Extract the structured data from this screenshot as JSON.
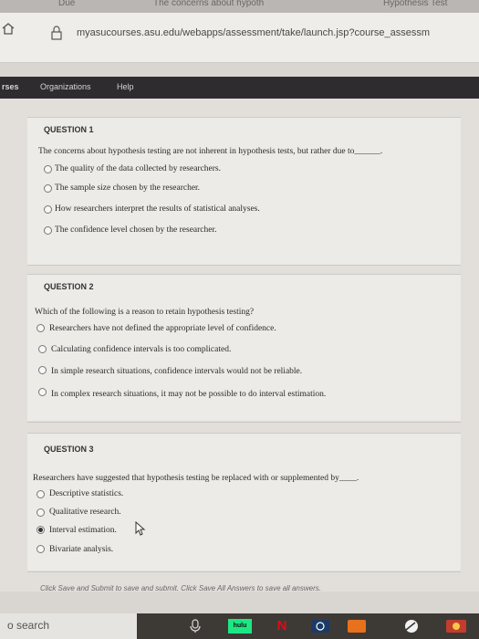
{
  "browser": {
    "tabs": [
      "Due",
      "The concerns about hypoth",
      "Hypothesis Test"
    ],
    "url": "myasucourses.asu.edu/webapps/assessment/take/launch.jsp?course_assessm"
  },
  "nav": {
    "courses": "rses",
    "organizations": "Organizations",
    "help": "Help"
  },
  "questions": [
    {
      "heading": "QUESTION 1",
      "text": "The concerns about hypothesis testing are not inherent in hypothesis tests, but rather due to______.",
      "options": [
        "The quality of the data collected by researchers.",
        "The sample size chosen by the researcher.",
        "How researchers interpret the results of statistical analyses.",
        "The confidence level chosen by the researcher."
      ],
      "selected": -1
    },
    {
      "heading": "QUESTION 2",
      "text": "Which of the following is a reason to retain hypothesis testing?",
      "options": [
        "Researchers have not defined the appropriate level of confidence.",
        "Calculating confidence intervals is too complicated.",
        "In simple research situations, confidence intervals would not be reliable.",
        "In complex research situations, it may not be possible to do interval estimation."
      ],
      "selected": -1
    },
    {
      "heading": "QUESTION 3",
      "text": "Researchers have suggested that hypothesis testing be replaced with or supplemented by____.",
      "options": [
        "Descriptive statistics.",
        "Qualitative research.",
        "Interval estimation.",
        "Bivariate analysis."
      ],
      "selected": 2
    }
  ],
  "footer": {
    "note": "Click Save and Submit to save and submit. Click Save All Answers to save all answers."
  },
  "taskbar": {
    "search": "o search",
    "hulu": "hulu",
    "netflix": "N"
  }
}
